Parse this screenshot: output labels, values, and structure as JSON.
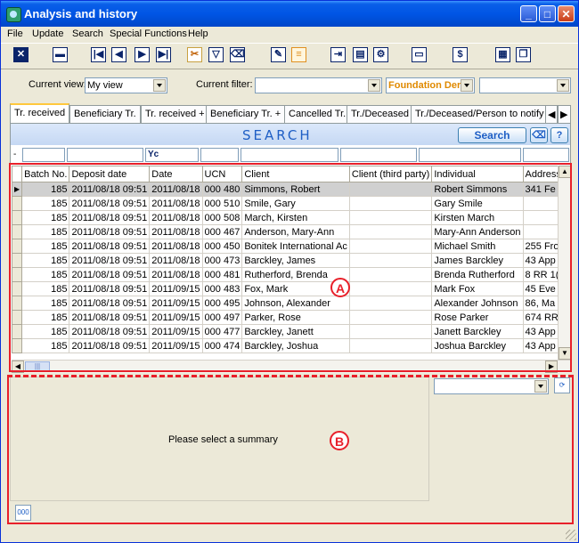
{
  "window": {
    "title": "Analysis and history",
    "minimize": "_",
    "maximize": "□",
    "close": "✕"
  },
  "menu": [
    "File",
    "Update",
    "Search",
    "Special Functions",
    "Help"
  ],
  "toolbar_icons": [
    "close-icon",
    "save-icon",
    "first-record-icon",
    "previous-record-icon",
    "next-record-icon",
    "last-record-icon",
    "tools-icon",
    "filter-icon",
    "eraser-icon",
    "edit-icon",
    "list-icon",
    "export-icon",
    "report-icon",
    "report-settings-icon",
    "folder-icon",
    "dollar-icon",
    "print-icon",
    "duplicate-icon"
  ],
  "view": {
    "current_view_label": "Current view:",
    "current_view_value": "My view",
    "current_filter_label": "Current filter:",
    "current_filter_value": "",
    "foundation_value": "Foundation Der",
    "extra_value": ""
  },
  "tabs": [
    "Tr. received",
    "Beneficiary Tr.",
    "Tr. received +",
    "Beneficiary Tr. +",
    "Cancelled Tr.",
    "Tr./Deceased",
    "Tr./Deceased/Person to notify"
  ],
  "search": {
    "title": "SEARCH",
    "button": "Search",
    "help": "?",
    "filter_prefix": "-",
    "date_filter": "Yc"
  },
  "columns": [
    "Batch No.",
    "Deposit date",
    "Date",
    "UCN",
    "Client",
    "Client (third party)",
    "Individual",
    "Address"
  ],
  "rows": [
    [
      "185",
      "2011/08/18 09:51",
      "2011/08/18",
      "000 480",
      "Simmons, Robert",
      "",
      "Robert Simmons",
      "341 Fe"
    ],
    [
      "185",
      "2011/08/18 09:51",
      "2011/08/18",
      "000 510",
      "Smile, Gary",
      "",
      "Gary Smile",
      ""
    ],
    [
      "185",
      "2011/08/18 09:51",
      "2011/08/18",
      "000 508",
      "March, Kirsten",
      "",
      "Kirsten March",
      ""
    ],
    [
      "185",
      "2011/08/18 09:51",
      "2011/08/18",
      "000 467",
      "Anderson, Mary-Ann",
      "",
      "Mary-Ann Anderson",
      ""
    ],
    [
      "185",
      "2011/08/18 09:51",
      "2011/08/18",
      "000 450",
      "Bonitek International Ac",
      "",
      "Michael Smith",
      "255 Fro"
    ],
    [
      "185",
      "2011/08/18 09:51",
      "2011/08/18",
      "000 473",
      "Barckley, James",
      "",
      "James Barckley",
      "43 App"
    ],
    [
      "185",
      "2011/08/18 09:51",
      "2011/08/18",
      "000 481",
      "Rutherford, Brenda",
      "",
      "Brenda Rutherford",
      "8 RR 1("
    ],
    [
      "185",
      "2011/08/18 09:51",
      "2011/09/15",
      "000 483",
      "Fox, Mark",
      "",
      "Mark Fox",
      "45 Eve"
    ],
    [
      "185",
      "2011/08/18 09:51",
      "2011/09/15",
      "000 495",
      "Johnson, Alexander",
      "",
      "Alexander Johnson",
      "86, Ma"
    ],
    [
      "185",
      "2011/08/18 09:51",
      "2011/09/15",
      "000 497",
      "Parker, Rose",
      "",
      "Rose Parker",
      "674 RR"
    ],
    [
      "185",
      "2011/08/18 09:51",
      "2011/09/15",
      "000 477",
      "Barckley, Janett",
      "",
      "Janett Barckley",
      "43 App"
    ],
    [
      "185",
      "2011/08/18 09:51",
      "2011/09/15",
      "000 474",
      "Barckley, Joshua",
      "",
      "Joshua Barckley",
      "43 App"
    ]
  ],
  "summary": {
    "message": "Please select a summary",
    "bottom_button": "000"
  },
  "annotations": {
    "a": "A",
    "b": "B"
  }
}
